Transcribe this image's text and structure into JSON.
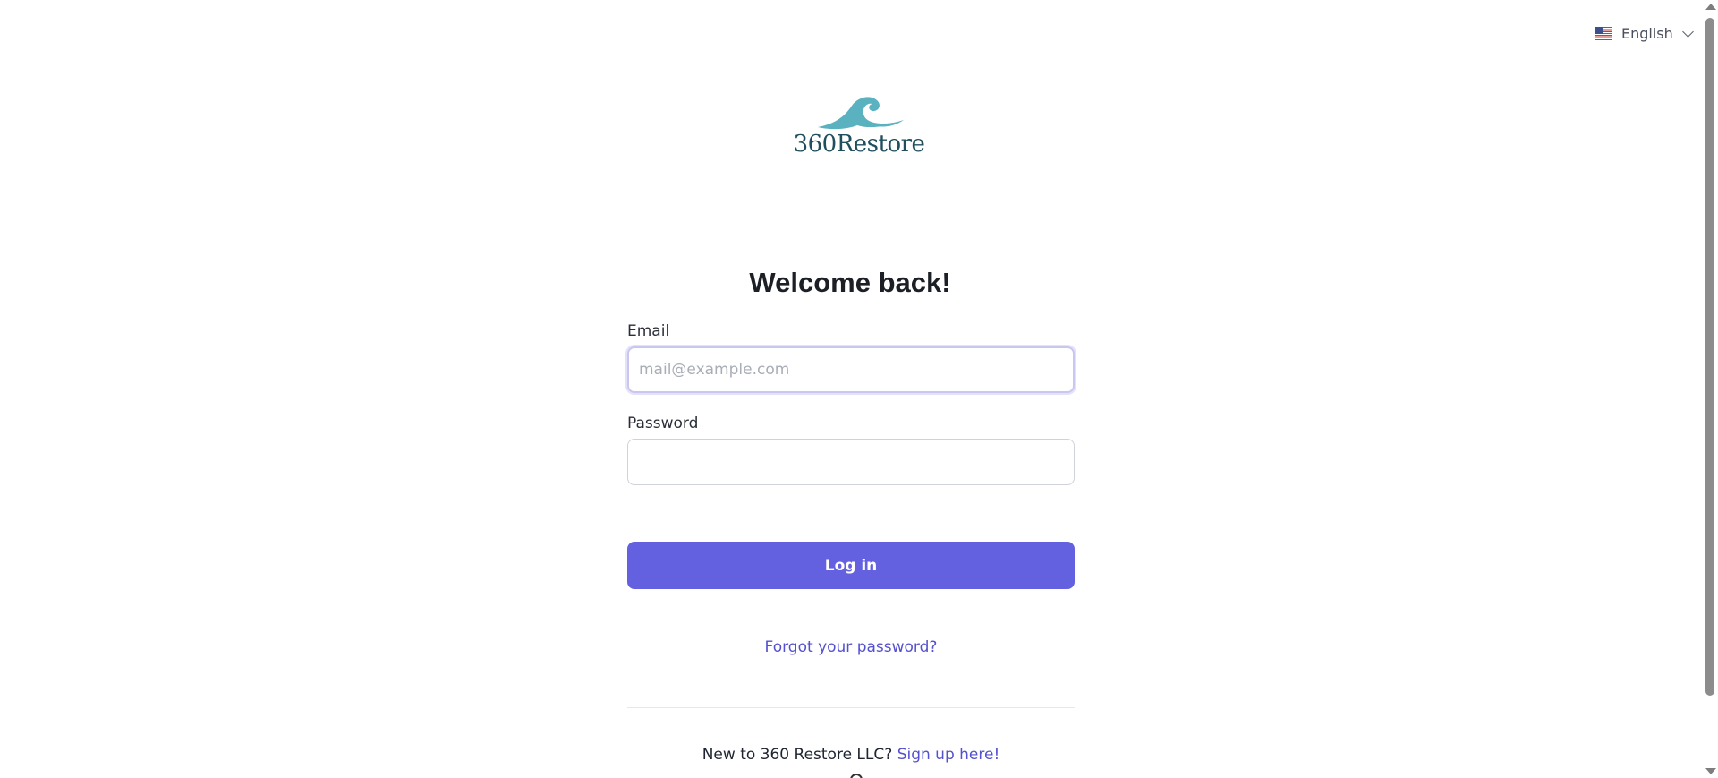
{
  "language": {
    "selected": "English",
    "flag_icon": "us-flag-icon",
    "chevron_icon": "chevron-down-icon"
  },
  "logo": {
    "text": "360Restore",
    "colors": {
      "wave": "#5ab2c0",
      "text": "#1f4f5e"
    }
  },
  "heading": "Welcome back!",
  "form": {
    "email_label": "Email",
    "email_placeholder": "mail@example.com",
    "email_value": "",
    "password_label": "Password",
    "password_value": "",
    "login_label": "Log in",
    "forgot_label": "Forgot your password?"
  },
  "signup": {
    "prompt": "New to 360 Restore LLC?",
    "link_label": "Sign up here!"
  },
  "colors": {
    "accent": "#6461e1",
    "link": "#5451cf"
  }
}
